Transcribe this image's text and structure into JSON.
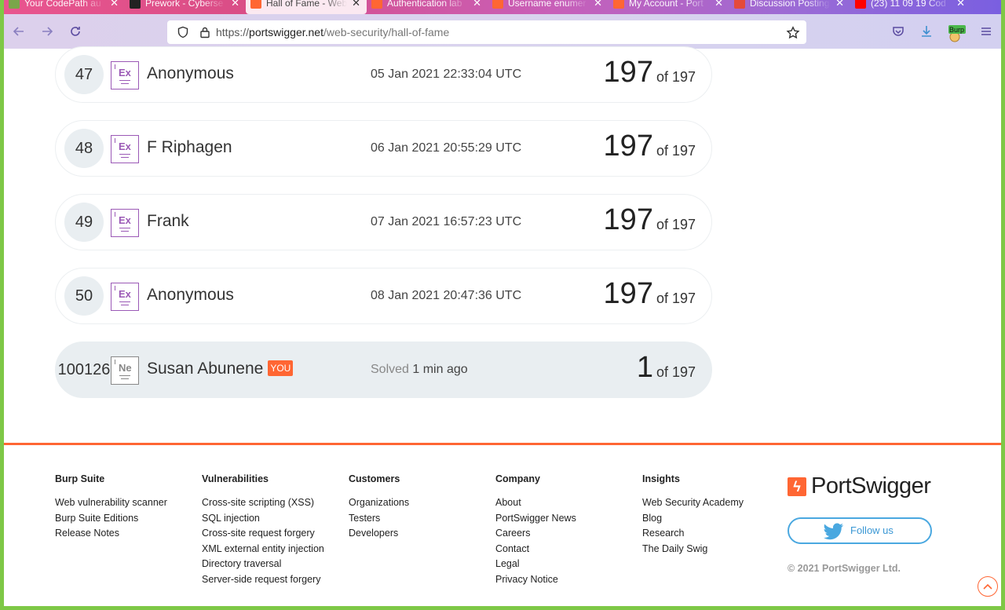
{
  "browser": {
    "tabs": [
      {
        "title": "Your CodePath au",
        "color": "#7aa64a"
      },
      {
        "title": "Prework - Cyberse",
        "color": "#222222"
      },
      {
        "title": "Hall of Fame - Web",
        "color": "#ff6633",
        "active": true
      },
      {
        "title": "Authentication lab",
        "color": "#ff6633"
      },
      {
        "title": "Username enumer",
        "color": "#ff6633"
      },
      {
        "title": "My Account - Port",
        "color": "#ff6633"
      },
      {
        "title": "Discussion Posting",
        "color": "#e54a3a"
      },
      {
        "title": "(23) 11 09 19 Cod",
        "color": "#ff0000"
      }
    ],
    "url_scheme": "https://",
    "url_host": "portswigger.net",
    "url_path": "/web-security/hall-of-fame",
    "burp_label": "Burp"
  },
  "leaderboard": {
    "rows": [
      {
        "rank": "47",
        "badge": "Ex",
        "name": "Anonymous",
        "date": "05 Jan 2021 22:33:04 UTC",
        "score": "197",
        "total": "of 197"
      },
      {
        "rank": "48",
        "badge": "Ex",
        "name": "F Riphagen",
        "date": "06 Jan 2021 20:55:29 UTC",
        "score": "197",
        "total": "of 197"
      },
      {
        "rank": "49",
        "badge": "Ex",
        "name": "Frank",
        "date": "07 Jan 2021 16:57:23 UTC",
        "score": "197",
        "total": "of 197"
      },
      {
        "rank": "50",
        "badge": "Ex",
        "name": "Anonymous",
        "date": "08 Jan 2021 20:47:36 UTC",
        "score": "197",
        "total": "of 197"
      }
    ],
    "you_row": {
      "rank": "100126",
      "badge": "Ne",
      "name": "Susan Abunene",
      "you_tag": "YOU",
      "solved_label": "Solved",
      "solved_time": "1 min ago",
      "score": "1",
      "total": "of 197"
    }
  },
  "footer": {
    "burp": {
      "heading": "Burp Suite",
      "links": [
        "Web vulnerability scanner",
        "Burp Suite Editions",
        "Release Notes"
      ]
    },
    "vulns": {
      "heading": "Vulnerabilities",
      "links": [
        "Cross-site scripting (XSS)",
        "SQL injection",
        "Cross-site request forgery",
        "XML external entity injection",
        "Directory traversal",
        "Server-side request forgery"
      ]
    },
    "customers": {
      "heading": "Customers",
      "links": [
        "Organizations",
        "Testers",
        "Developers"
      ]
    },
    "company": {
      "heading": "Company",
      "links": [
        "About",
        "PortSwigger News",
        "Careers",
        "Contact",
        "Legal",
        "Privacy Notice"
      ]
    },
    "insights": {
      "heading": "Insights",
      "links": [
        "Web Security Academy",
        "Blog",
        "Research",
        "The Daily Swig"
      ]
    },
    "logo_text": "PortSwigger",
    "follow_label": "Follow us",
    "copyright": "© 2021 PortSwigger Ltd."
  },
  "colors": {
    "accent": "#ff6633",
    "badge_purple": "#9b59b6",
    "twitter": "#4aa8e0"
  }
}
